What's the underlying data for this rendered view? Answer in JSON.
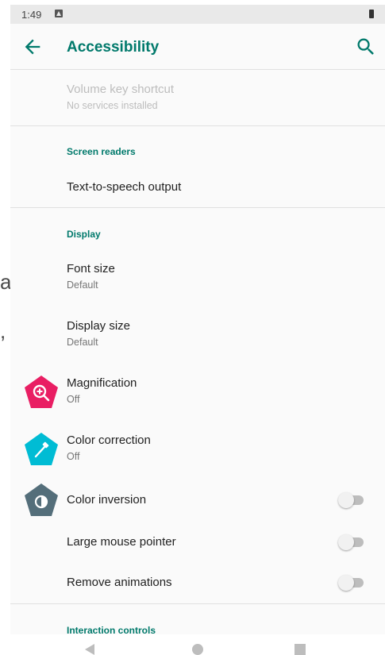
{
  "status_bar": {
    "time": "1:49"
  },
  "app_bar": {
    "title": "Accessibility"
  },
  "bleed_text": {
    "line1": "all,",
    "line2": ","
  },
  "volume_key": {
    "title": "Volume key shortcut",
    "summary": "No services installed"
  },
  "screen_readers": {
    "header": "Screen readers",
    "tts": "Text-to-speech output"
  },
  "display": {
    "header": "Display",
    "font_size": {
      "title": "Font size",
      "summary": "Default"
    },
    "display_size": {
      "title": "Display size",
      "summary": "Default"
    },
    "magnification": {
      "title": "Magnification",
      "summary": "Off"
    },
    "color_correction": {
      "title": "Color correction",
      "summary": "Off"
    },
    "color_inversion": {
      "title": "Color inversion",
      "enabled": false
    },
    "large_pointer": {
      "title": "Large mouse pointer",
      "enabled": false
    },
    "remove_animations": {
      "title": "Remove animations",
      "enabled": false
    }
  },
  "interaction": {
    "header": "Interaction controls"
  },
  "colors": {
    "accent": "#00796b",
    "magnification_icon": "#e91e63",
    "color_correction_icon": "#00bcd4",
    "color_inversion_icon": "#546e7a"
  },
  "icons": [
    "back-arrow-icon",
    "search-icon",
    "magnification-icon",
    "color-correction-icon",
    "color-inversion-icon",
    "back-nav-icon",
    "home-nav-icon",
    "recents-nav-icon"
  ]
}
